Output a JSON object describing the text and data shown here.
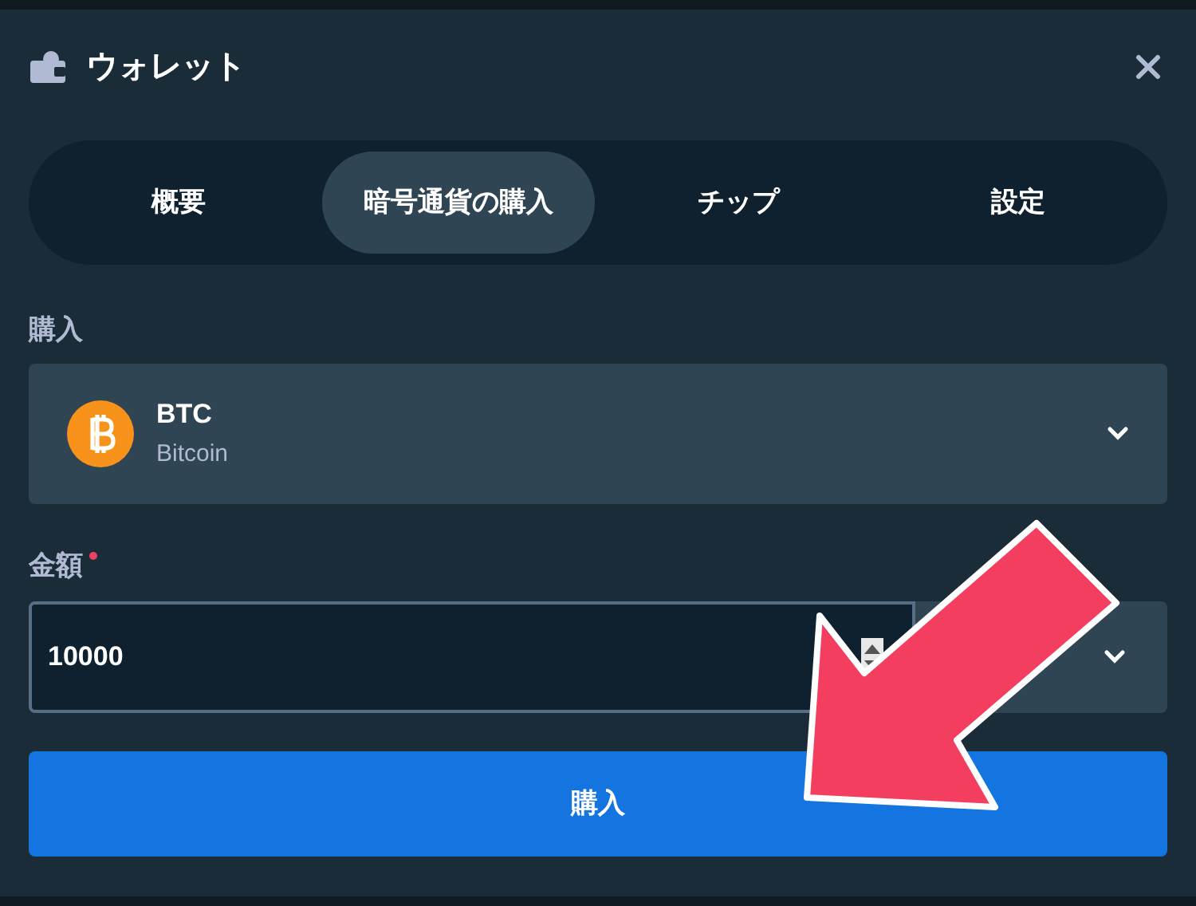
{
  "window": {
    "title": "ウォレット"
  },
  "tabs": [
    {
      "label": "概要",
      "selected": false
    },
    {
      "label": "暗号通貨の購入",
      "selected": true
    },
    {
      "label": "チップ",
      "selected": false
    },
    {
      "label": "設定",
      "selected": false
    }
  ],
  "purchase": {
    "label": "購入",
    "currency": {
      "code": "BTC",
      "name": "Bitcoin"
    }
  },
  "amount": {
    "label": "金額",
    "required": true,
    "value": "10000"
  },
  "buy_button": "購入"
}
